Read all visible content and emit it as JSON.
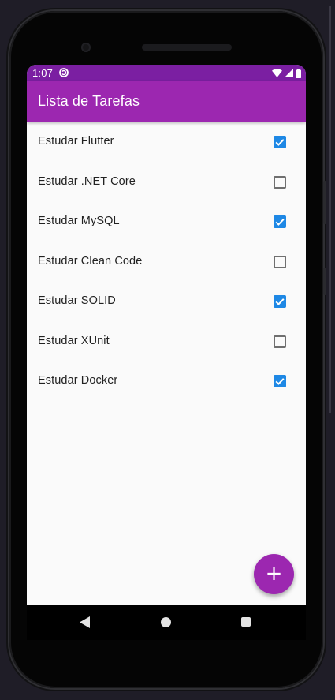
{
  "status_bar": {
    "time": "1:07",
    "icons": [
      "notification-icon",
      "wifi-icon",
      "signal-icon",
      "battery-icon"
    ]
  },
  "app_bar": {
    "title": "Lista de Tarefas"
  },
  "tasks": [
    {
      "label": "Estudar Flutter",
      "done": true
    },
    {
      "label": "Estudar .NET Core",
      "done": false
    },
    {
      "label": "Estudar MySQL",
      "done": true
    },
    {
      "label": "Estudar Clean Code",
      "done": false
    },
    {
      "label": "Estudar SOLID",
      "done": true
    },
    {
      "label": "Estudar XUnit",
      "done": false
    },
    {
      "label": "Estudar Docker",
      "done": true
    }
  ],
  "fab": {
    "label": "+"
  },
  "nav_bar": {
    "buttons": [
      "back-icon",
      "home-icon",
      "recents-icon"
    ]
  },
  "colors": {
    "primary": "#9c27b0",
    "primary_dark": "#7b1fa2",
    "checkbox_accent": "#1e88e5",
    "background": "#fafafa"
  }
}
